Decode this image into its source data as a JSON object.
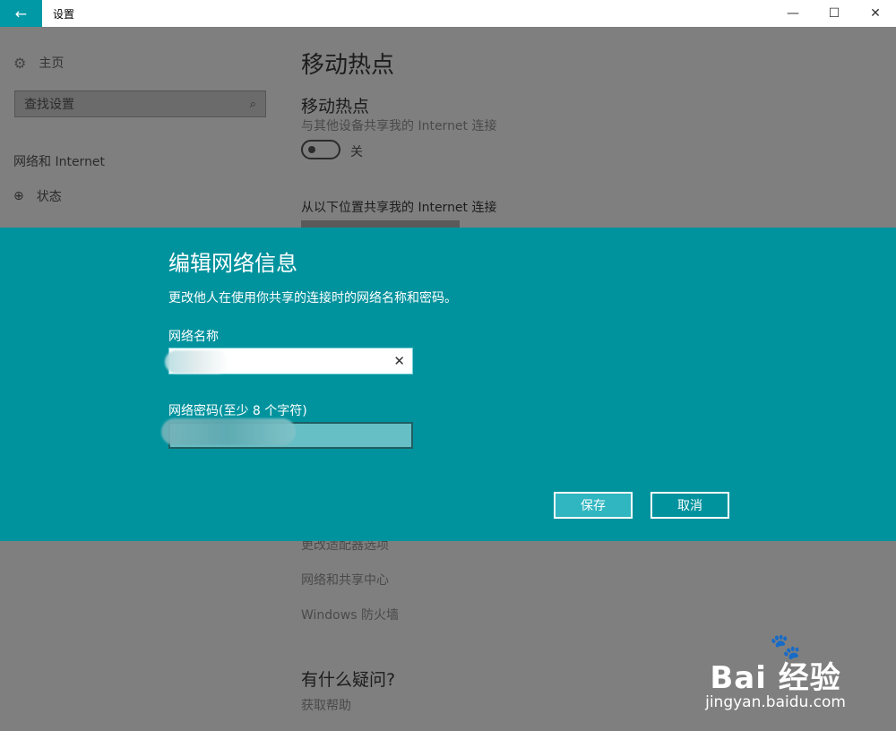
{
  "window": {
    "title": "设置",
    "back_icon": "arrow-left-icon",
    "controls": [
      "minimize-icon",
      "maximize-icon",
      "close-icon"
    ]
  },
  "sidebar": {
    "home_label": "主页",
    "search_placeholder": "查找设置",
    "section_heading": "网络和 Internet",
    "status_label": "状态"
  },
  "main": {
    "page_title": "移动热点",
    "hotspot_title": "移动热点",
    "hotspot_desc": "与其他设备共享我的 Internet 连接",
    "toggle_state": "关",
    "share_from_label": "从以下位置共享我的 Internet 连接",
    "links": [
      "更改适配器选项",
      "网络和共享中心",
      "Windows 防火墙"
    ],
    "help_title": "有什么疑问?",
    "help_link": "获取帮助"
  },
  "dialog": {
    "title": "编辑网络信息",
    "description": "更改他人在使用你共享的连接时的网络名称和密码。",
    "network_name_label": "网络名称",
    "network_name_value": "",
    "network_password_label": "网络密码(至少 8 个字符)",
    "network_password_value": "",
    "save_label": "保存",
    "cancel_label": "取消"
  },
  "watermark": {
    "logo": "Bai 经验",
    "url": "jingyan.baidu.com"
  },
  "colors": {
    "accent": "#0099a5",
    "dialog_bg": "#00939e",
    "overlay": "#7f7f7f"
  }
}
